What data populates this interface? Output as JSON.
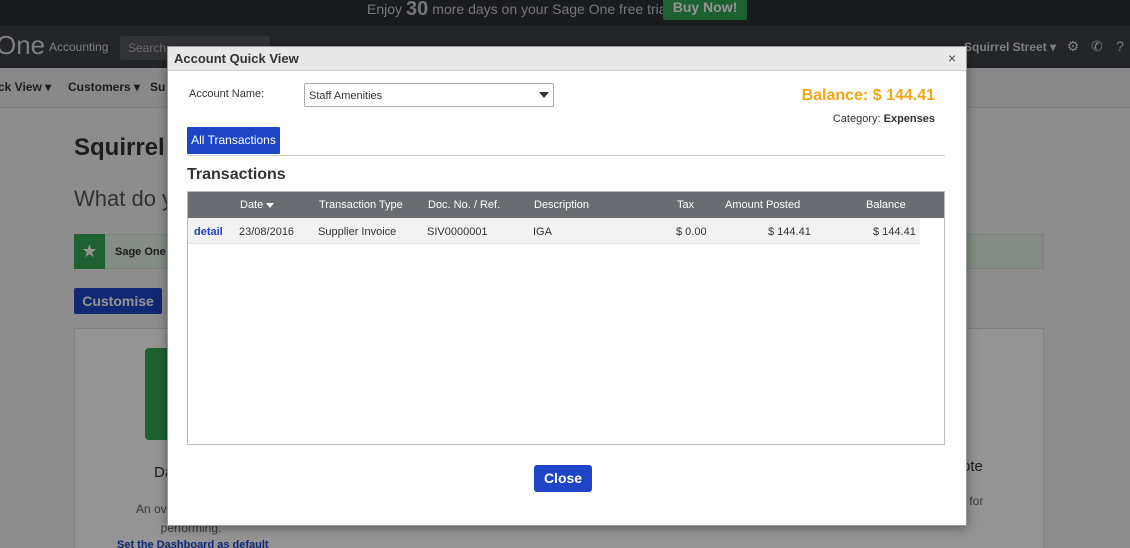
{
  "promo": {
    "prefix": "Enjoy",
    "days": "30",
    "suffix": "more days on your Sage One free trial.",
    "buy_label": "Buy Now!"
  },
  "nav": {
    "logo": "One",
    "product": "Accounting",
    "search_placeholder": "Search",
    "company": "Squirrel Street ▾"
  },
  "menu": {
    "items": [
      "ck View ▾",
      "Customers ▾",
      "Su"
    ]
  },
  "page": {
    "company_title": "Squirrel S",
    "what_do": "What do y",
    "notice_text": "Sage One i",
    "customise_label": "Customise",
    "panel_left_title": "Da",
    "panel_left_desc": "An overv business is performing.",
    "panel_left_link": "Set the Dashboard as default",
    "panel_right_title": "ote",
    "panel_right_desc": "r for"
  },
  "modal": {
    "title": "Account Quick View",
    "close_icon": "×",
    "account_label": "Account Name:",
    "account_value": "Staff Amenities",
    "balance_label": "Balance:",
    "balance_value": "$ 144.41",
    "category_label": "Category:",
    "category_value": "Expenses",
    "tab_label": "All Transactions",
    "section_title": "Transactions",
    "columns": {
      "date": "Date",
      "type": "Transaction Type",
      "doc": "Doc. No. / Ref.",
      "desc": "Description",
      "tax": "Tax",
      "amount": "Amount Posted",
      "balance": "Balance"
    },
    "rows": [
      {
        "link": "detail",
        "date": "23/08/2016",
        "type": "Supplier Invoice",
        "doc": "SIV0000001",
        "desc": "IGA",
        "tax": "$ 0.00",
        "amount": "$ 144.41",
        "balance": "$ 144.41"
      }
    ],
    "close_button": "Close"
  },
  "colors": {
    "accent": "#1d45c5",
    "balance": "#f2a614",
    "buy_now": "#34a853"
  }
}
